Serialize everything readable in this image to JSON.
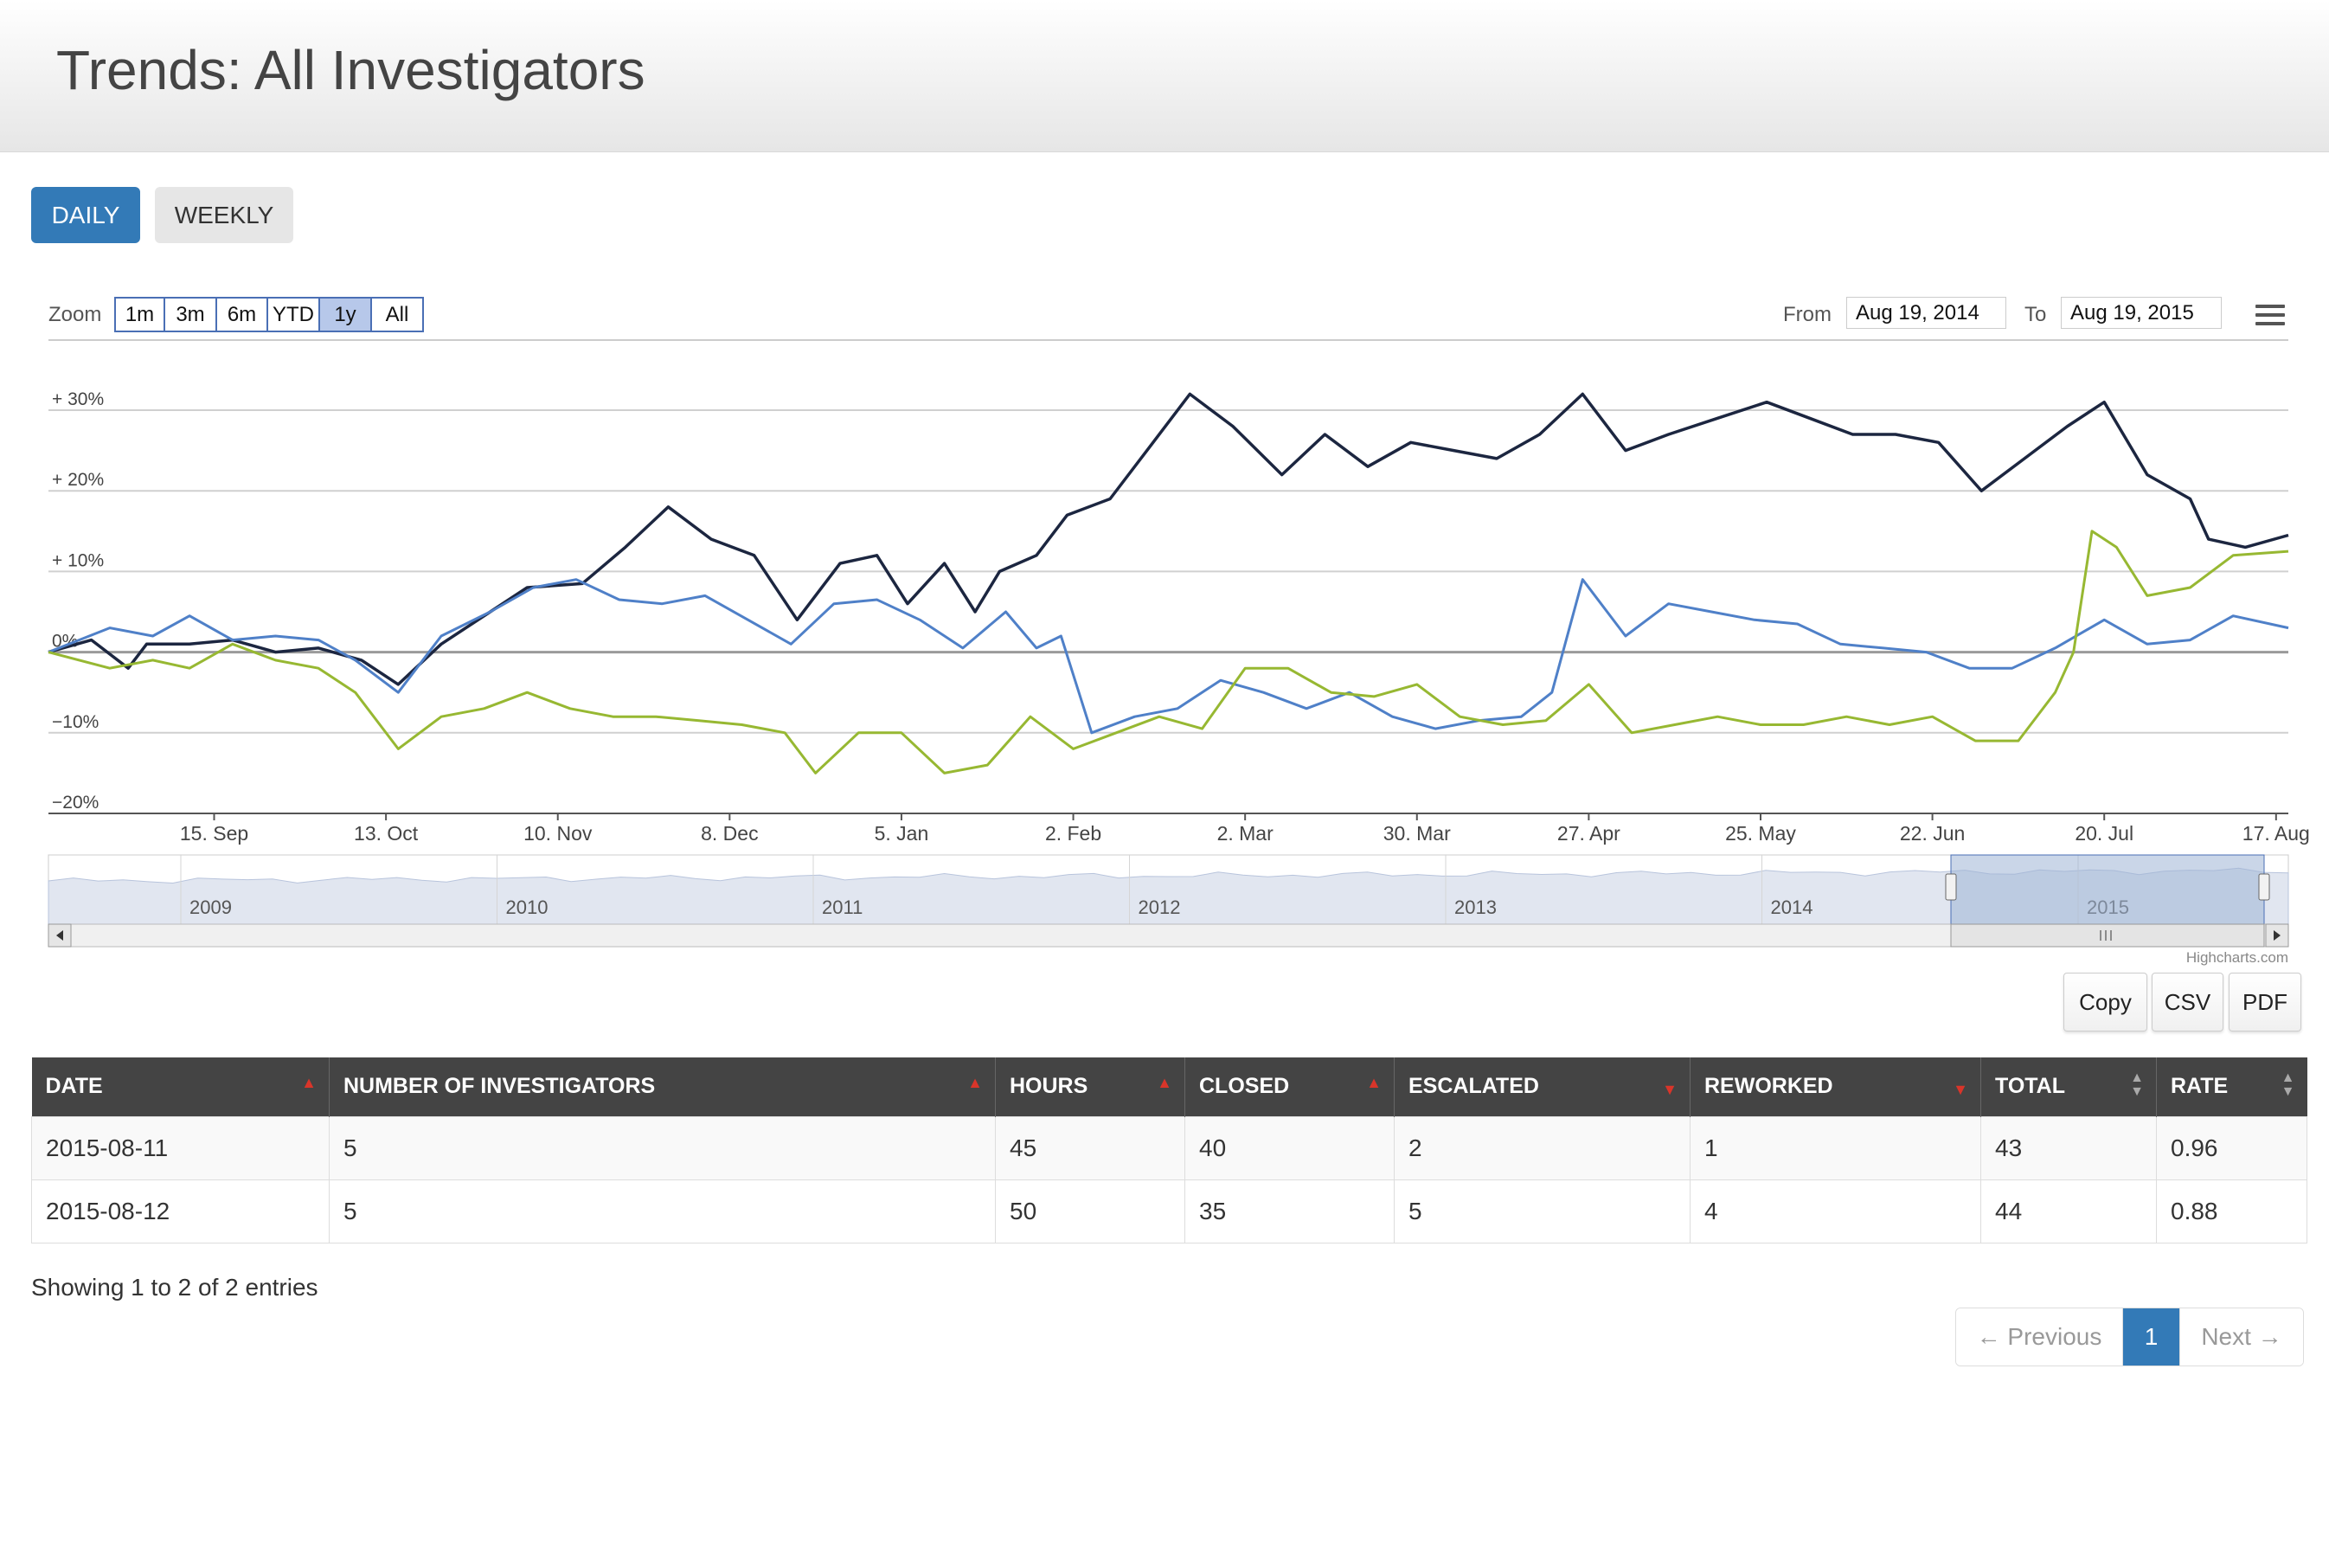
{
  "page": {
    "title": "Trends: All Investigators"
  },
  "view_tabs": {
    "daily": "DAILY",
    "weekly": "WEEKLY",
    "active": "DAILY"
  },
  "range_selector": {
    "zoom_label": "Zoom",
    "buttons": [
      "1m",
      "3m",
      "6m",
      "YTD",
      "1y",
      "All"
    ],
    "active": "1y",
    "from_label": "From",
    "from_value": "Aug 19, 2014",
    "to_label": "To",
    "to_value": "Aug 19, 2015"
  },
  "chart_data": {
    "type": "line",
    "y_unit": "%",
    "ylim": [
      -20,
      30
    ],
    "y_ticks": [
      "+ 30%",
      "+ 20%",
      "+ 10%",
      "0%",
      "−10%",
      "−20%"
    ],
    "x_range": [
      "2014-08-19",
      "2015-08-19"
    ],
    "x_ticks": [
      {
        "date": "2014-09-15",
        "label": "15. Sep"
      },
      {
        "date": "2014-10-13",
        "label": "13. Oct"
      },
      {
        "date": "2014-11-10",
        "label": "10. Nov"
      },
      {
        "date": "2014-12-08",
        "label": "8. Dec"
      },
      {
        "date": "2015-01-05",
        "label": "5. Jan"
      },
      {
        "date": "2015-02-02",
        "label": "2. Feb"
      },
      {
        "date": "2015-03-02",
        "label": "2. Mar"
      },
      {
        "date": "2015-03-30",
        "label": "30. Mar"
      },
      {
        "date": "2015-04-27",
        "label": "27. Apr"
      },
      {
        "date": "2015-05-25",
        "label": "25. May"
      },
      {
        "date": "2015-06-22",
        "label": "22. Jun"
      },
      {
        "date": "2015-07-20",
        "label": "20. Jul"
      },
      {
        "date": "2015-08-17",
        "label": "17. Aug"
      }
    ],
    "grid": true,
    "legend": "none",
    "series": [
      {
        "color": "#1c2640",
        "points": [
          [
            "2014-08-19",
            0
          ],
          [
            "2014-08-26",
            1.5
          ],
          [
            "2014-09-01",
            -2
          ],
          [
            "2014-09-04",
            1
          ],
          [
            "2014-09-11",
            1
          ],
          [
            "2014-09-18",
            1.5
          ],
          [
            "2014-09-25",
            0
          ],
          [
            "2014-10-02",
            0.5
          ],
          [
            "2014-10-09",
            -1
          ],
          [
            "2014-10-15",
            -4
          ],
          [
            "2014-10-22",
            1
          ],
          [
            "2014-10-30",
            5
          ],
          [
            "2014-11-05",
            8
          ],
          [
            "2014-11-14",
            8.5
          ],
          [
            "2014-11-21",
            13
          ],
          [
            "2014-11-28",
            18
          ],
          [
            "2014-12-05",
            14
          ],
          [
            "2014-12-12",
            12
          ],
          [
            "2014-12-19",
            4
          ],
          [
            "2014-12-26",
            11
          ],
          [
            "2015-01-01",
            12
          ],
          [
            "2015-01-06",
            6
          ],
          [
            "2015-01-12",
            11
          ],
          [
            "2015-01-17",
            5
          ],
          [
            "2015-01-21",
            10
          ],
          [
            "2015-01-27",
            12
          ],
          [
            "2015-02-01",
            17
          ],
          [
            "2015-02-08",
            19
          ],
          [
            "2015-02-15",
            26
          ],
          [
            "2015-02-21",
            32
          ],
          [
            "2015-02-28",
            28
          ],
          [
            "2015-03-08",
            22
          ],
          [
            "2015-03-15",
            27
          ],
          [
            "2015-03-22",
            23
          ],
          [
            "2015-03-29",
            26
          ],
          [
            "2015-04-05",
            25
          ],
          [
            "2015-04-12",
            24
          ],
          [
            "2015-04-19",
            27
          ],
          [
            "2015-04-26",
            32
          ],
          [
            "2015-05-03",
            25
          ],
          [
            "2015-05-10",
            27
          ],
          [
            "2015-05-18",
            29
          ],
          [
            "2015-05-26",
            31
          ],
          [
            "2015-06-02",
            29
          ],
          [
            "2015-06-09",
            27
          ],
          [
            "2015-06-16",
            27
          ],
          [
            "2015-06-23",
            26
          ],
          [
            "2015-06-30",
            20
          ],
          [
            "2015-07-07",
            24
          ],
          [
            "2015-07-14",
            28
          ],
          [
            "2015-07-20",
            31
          ],
          [
            "2015-07-27",
            22
          ],
          [
            "2015-08-03",
            19
          ],
          [
            "2015-08-06",
            14
          ],
          [
            "2015-08-12",
            13
          ],
          [
            "2015-08-19",
            14.5
          ]
        ]
      },
      {
        "color": "#4f80c8",
        "points": [
          [
            "2014-08-19",
            0
          ],
          [
            "2014-08-29",
            3
          ],
          [
            "2014-09-05",
            2
          ],
          [
            "2014-09-11",
            4.5
          ],
          [
            "2014-09-18",
            1.5
          ],
          [
            "2014-09-25",
            2
          ],
          [
            "2014-10-02",
            1.5
          ],
          [
            "2014-10-08",
            -1
          ],
          [
            "2014-10-15",
            -5
          ],
          [
            "2014-10-22",
            2
          ],
          [
            "2014-10-30",
            5
          ],
          [
            "2014-11-06",
            8
          ],
          [
            "2014-11-13",
            9
          ],
          [
            "2014-11-20",
            6.5
          ],
          [
            "2014-11-27",
            6
          ],
          [
            "2014-12-04",
            7
          ],
          [
            "2014-12-11",
            4
          ],
          [
            "2014-12-18",
            1
          ],
          [
            "2014-12-25",
            6
          ],
          [
            "2015-01-01",
            6.5
          ],
          [
            "2015-01-08",
            4
          ],
          [
            "2015-01-15",
            0.5
          ],
          [
            "2015-01-22",
            5
          ],
          [
            "2015-01-27",
            0.5
          ],
          [
            "2015-01-31",
            2
          ],
          [
            "2015-02-05",
            -10
          ],
          [
            "2015-02-12",
            -8
          ],
          [
            "2015-02-19",
            -7
          ],
          [
            "2015-02-26",
            -3.5
          ],
          [
            "2015-03-05",
            -5
          ],
          [
            "2015-03-12",
            -7
          ],
          [
            "2015-03-19",
            -5
          ],
          [
            "2015-03-26",
            -8
          ],
          [
            "2015-04-02",
            -9.5
          ],
          [
            "2015-04-09",
            -8.5
          ],
          [
            "2015-04-16",
            -8
          ],
          [
            "2015-04-21",
            -5
          ],
          [
            "2015-04-26",
            9
          ],
          [
            "2015-05-03",
            2
          ],
          [
            "2015-05-10",
            6
          ],
          [
            "2015-05-17",
            5
          ],
          [
            "2015-05-24",
            4
          ],
          [
            "2015-05-31",
            3.5
          ],
          [
            "2015-06-07",
            1
          ],
          [
            "2015-06-14",
            0.5
          ],
          [
            "2015-06-21",
            0
          ],
          [
            "2015-06-28",
            -2
          ],
          [
            "2015-07-05",
            -2
          ],
          [
            "2015-07-12",
            0.5
          ],
          [
            "2015-07-20",
            4
          ],
          [
            "2015-07-27",
            1
          ],
          [
            "2015-08-03",
            1.5
          ],
          [
            "2015-08-10",
            4.5
          ],
          [
            "2015-08-19",
            3
          ]
        ]
      },
      {
        "color": "#97b832",
        "points": [
          [
            "2014-08-19",
            0
          ],
          [
            "2014-08-29",
            -2
          ],
          [
            "2014-09-05",
            -1
          ],
          [
            "2014-09-11",
            -2
          ],
          [
            "2014-09-18",
            1
          ],
          [
            "2014-09-25",
            -1
          ],
          [
            "2014-10-02",
            -2
          ],
          [
            "2014-10-08",
            -5
          ],
          [
            "2014-10-15",
            -12
          ],
          [
            "2014-10-22",
            -8
          ],
          [
            "2014-10-29",
            -7
          ],
          [
            "2014-11-05",
            -5
          ],
          [
            "2014-11-12",
            -7
          ],
          [
            "2014-11-19",
            -8
          ],
          [
            "2014-11-26",
            -8
          ],
          [
            "2014-12-03",
            -8.5
          ],
          [
            "2014-12-10",
            -9
          ],
          [
            "2014-12-17",
            -10
          ],
          [
            "2014-12-22",
            -15
          ],
          [
            "2014-12-29",
            -10
          ],
          [
            "2015-01-05",
            -10
          ],
          [
            "2015-01-12",
            -15
          ],
          [
            "2015-01-19",
            -14
          ],
          [
            "2015-01-26",
            -8
          ],
          [
            "2015-02-02",
            -12
          ],
          [
            "2015-02-09",
            -10
          ],
          [
            "2015-02-16",
            -8
          ],
          [
            "2015-02-23",
            -9.5
          ],
          [
            "2015-03-02",
            -2
          ],
          [
            "2015-03-09",
            -2
          ],
          [
            "2015-03-16",
            -5
          ],
          [
            "2015-03-23",
            -5.5
          ],
          [
            "2015-03-30",
            -4
          ],
          [
            "2015-04-06",
            -8
          ],
          [
            "2015-04-13",
            -9
          ],
          [
            "2015-04-20",
            -8.5
          ],
          [
            "2015-04-27",
            -4
          ],
          [
            "2015-05-04",
            -10
          ],
          [
            "2015-05-11",
            -9
          ],
          [
            "2015-05-18",
            -8
          ],
          [
            "2015-05-25",
            -9
          ],
          [
            "2015-06-01",
            -9
          ],
          [
            "2015-06-08",
            -8
          ],
          [
            "2015-06-15",
            -9
          ],
          [
            "2015-06-22",
            -8
          ],
          [
            "2015-06-29",
            -11
          ],
          [
            "2015-07-06",
            -11
          ],
          [
            "2015-07-12",
            -5
          ],
          [
            "2015-07-15",
            0
          ],
          [
            "2015-07-18",
            15
          ],
          [
            "2015-07-22",
            13
          ],
          [
            "2015-07-27",
            7
          ],
          [
            "2015-08-03",
            8
          ],
          [
            "2015-08-10",
            12
          ],
          [
            "2015-08-19",
            12.5
          ]
        ]
      }
    ]
  },
  "navigator": {
    "years": [
      "2009",
      "2010",
      "2011",
      "2012",
      "2013",
      "2014",
      "2015"
    ]
  },
  "credits": "Highcharts.com",
  "export_buttons": {
    "copy": "Copy",
    "csv": "CSV",
    "pdf": "PDF"
  },
  "table": {
    "columns": [
      "DATE",
      "NUMBER OF INVESTIGATORS",
      "HOURS",
      "CLOSED",
      "ESCALATED",
      "REWORKED",
      "TOTAL",
      "RATE"
    ],
    "rows": [
      [
        "2015-08-11",
        "5",
        "45",
        "40",
        "2",
        "1",
        "43",
        "0.96"
      ],
      [
        "2015-08-12",
        "5",
        "50",
        "35",
        "5",
        "4",
        "44",
        "0.88"
      ]
    ],
    "info": "Showing 1 to 2 of 2 entries"
  },
  "pagination": {
    "previous": "← Previous",
    "current": "1",
    "next": "Next →"
  }
}
